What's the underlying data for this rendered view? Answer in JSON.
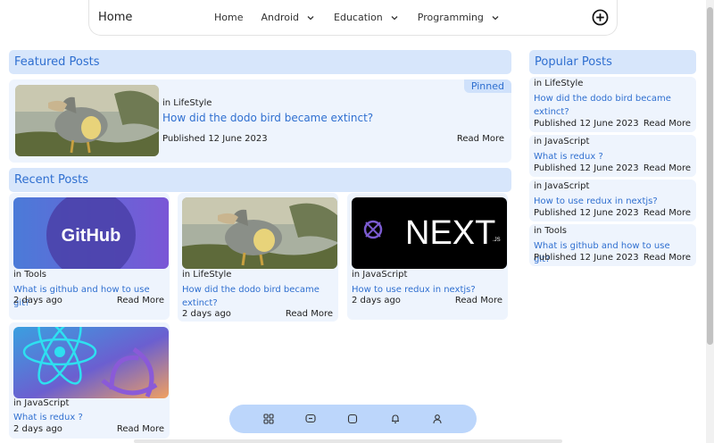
{
  "nav": {
    "brand": "Home",
    "items": [
      {
        "label": "Home",
        "dropdown": false
      },
      {
        "label": "Android",
        "dropdown": true
      },
      {
        "label": "Education",
        "dropdown": true
      },
      {
        "label": "Programming",
        "dropdown": true
      }
    ],
    "action_icon": "add-circle-icon"
  },
  "featured": {
    "heading": "Featured Posts",
    "badge": "Pinned",
    "post": {
      "category": "in LifeStyle",
      "title": "How did the dodo bird became extinct?",
      "date": "Published 12 June 2023",
      "read_more": "Read More",
      "image": "dodo-painting-image"
    }
  },
  "recent": {
    "heading": "Recent Posts",
    "posts": [
      {
        "category": "in Tools",
        "title": "What is github and how to use git?",
        "date": "2 days ago",
        "read_more": "Read More",
        "image": "github-logo-image",
        "image_text": "GitHub"
      },
      {
        "category": "in LifeStyle",
        "title": "How did the dodo bird became extinct?",
        "date": "2 days ago",
        "read_more": "Read More",
        "image": "dodo-painting-image"
      },
      {
        "category": "in JavaScript",
        "title": "How to use redux in nextjs?",
        "date": "2 days ago",
        "read_more": "Read More",
        "image": "nextjs-redux-image",
        "image_text": "NEXT",
        "image_subtext": ".JS"
      },
      {
        "category": "in JavaScript",
        "title": "What is redux ?",
        "date": "2 days ago",
        "read_more": "Read More",
        "image": "react-redux-image"
      }
    ]
  },
  "popular": {
    "heading": "Popular Posts",
    "posts": [
      {
        "category": "in LifeStyle",
        "title": "How did the dodo bird became extinct?",
        "date": "Published 12 June 2023",
        "read_more": "Read More"
      },
      {
        "category": "in JavaScript",
        "title": "What is redux ?",
        "date": "Published 12 June 2023",
        "read_more": "Read More"
      },
      {
        "category": "in JavaScript",
        "title": "How to use redux in nextjs?",
        "date": "Published 12 June 2023",
        "read_more": "Read More"
      },
      {
        "category": "in Tools",
        "title": "What is github and how to use git?",
        "date": "Published 12 June 2023",
        "read_more": "Read More"
      }
    ]
  },
  "bottom_bar": {
    "icons": [
      "grid-icon",
      "message-icon",
      "square-icon",
      "bell-icon",
      "user-icon"
    ]
  },
  "colors": {
    "accent": "#2f6fd0",
    "heading_bg": "#d7e6fb",
    "card_bg": "#eef4fd",
    "bottom_bar_bg": "#bcd6fb"
  }
}
